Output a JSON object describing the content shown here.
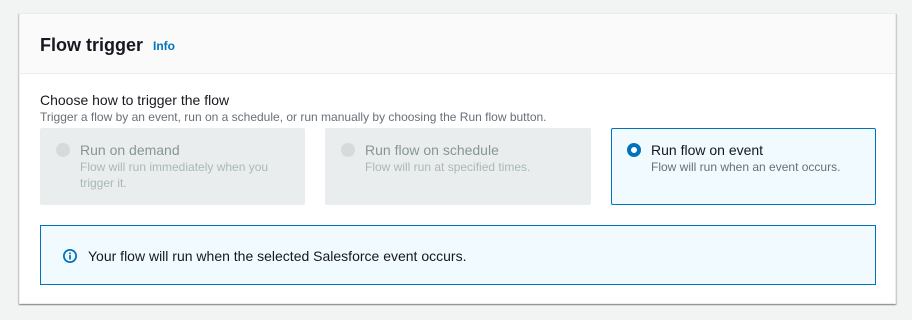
{
  "header": {
    "title": "Flow trigger",
    "info_label": "Info"
  },
  "trigger": {
    "label": "Choose how to trigger the flow",
    "description": "Trigger a flow by an event, run on a schedule, or run manually by choosing the Run flow button.",
    "options": [
      {
        "label": "Run on demand",
        "description_line1": "Flow will run immediately when you",
        "description_line2": "trigger it.",
        "state": "disabled"
      },
      {
        "label": "Run flow on schedule",
        "description_line1": "Flow will run at specified times.",
        "state": "disabled"
      },
      {
        "label": "Run flow on event",
        "description_line1": "Flow will run when an event occurs.",
        "state": "selected"
      }
    ]
  },
  "alert": {
    "icon": "info-icon",
    "text": "Your flow will run when the selected Salesforce event occurs."
  },
  "colors": {
    "accent": "#0073bb",
    "disabled_bg": "#eaeded",
    "selected_bg": "#f1faff"
  }
}
